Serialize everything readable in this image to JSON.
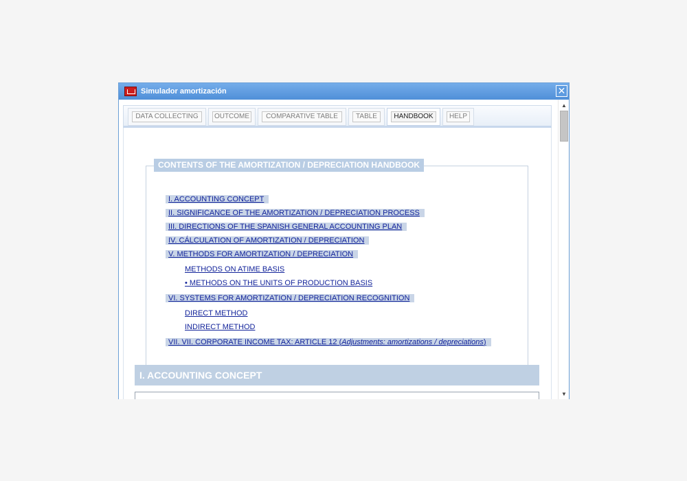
{
  "window": {
    "title": "Simulador amortización",
    "close_glyph": "✕",
    "icon": "app-icon"
  },
  "tabs": [
    {
      "label": "DATA COLLECTING",
      "active": false
    },
    {
      "label": "OUTCOME",
      "active": false
    },
    {
      "label": "COMPARATIVE TABLE",
      "active": false
    },
    {
      "label": "TABLE",
      "active": false
    },
    {
      "label": "HANDBOOK",
      "active": true
    },
    {
      "label": "HELP",
      "active": false
    }
  ],
  "handbook": {
    "toc_title": "CONTENTS OF THE AMORTIZATION / DEPRECIATION HANDBOOK",
    "items": [
      "I.  ACCOUNTING CONCEPT",
      "II.  SIGNIFICANCE OF THE AMORTIZATION / DEPRECIATION PROCESS",
      "III.  DIRECTIONS OF THE SPANISH GENERAL ACCOUNTING PLAN",
      "IV.  CÁLCULATION OF AMORTIZATION / DEPRECIATION",
      "V.  METHODS FOR AMORTIZATION / DEPRECIATION",
      "METHODS ON ATIME BASIS",
      "• METHODS ON THE UNITS OF PRODUCTION BASIS",
      "VI.  SYSTEMS FOR AMORTIZATION / DEPRECIATION RECOGNITION",
      "DIRECT METHOD",
      "INDIRECT METHOD"
    ],
    "item_vii": {
      "prefix": "VII.  VII. CORPORATE INCOME TAX: ARTICLE 12 (",
      "italic": "Adjustments: amortizations / depreciations",
      "suffix": ")"
    },
    "section_title": "I. ACCOUNTING CONCEPT"
  },
  "scrollbar": {
    "up_glyph": "▲",
    "down_glyph": "▼"
  },
  "colors": {
    "titlebar": "#4f8fd8",
    "link": "#12239a",
    "highlight": "#c9d5e7",
    "section": "#bfd0e3"
  }
}
